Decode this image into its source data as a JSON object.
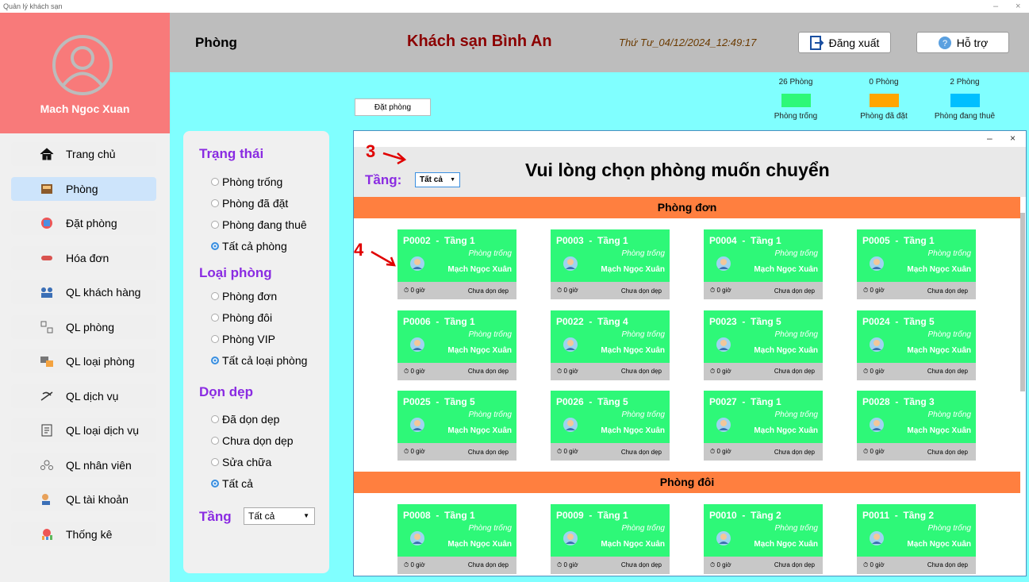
{
  "window": {
    "title": "Quản lý khách sạn",
    "minimize": "–",
    "close": "×"
  },
  "user": {
    "name": "Mach Ngoc Xuan"
  },
  "nav": [
    {
      "label": "Trang chủ",
      "icon": "home-icon"
    },
    {
      "label": "Phòng",
      "icon": "room-icon"
    },
    {
      "label": "Đặt phòng",
      "icon": "booking-icon"
    },
    {
      "label": "Hóa đơn",
      "icon": "invoice-icon"
    },
    {
      "label": "QL khách hàng",
      "icon": "customers-icon"
    },
    {
      "label": "QL phòng",
      "icon": "rooms-manage-icon"
    },
    {
      "label": "QL loại phòng",
      "icon": "room-types-icon"
    },
    {
      "label": "QL dịch vụ",
      "icon": "services-icon"
    },
    {
      "label": "QL loại dịch vụ",
      "icon": "service-types-icon"
    },
    {
      "label": "QL nhân viên",
      "icon": "staff-icon"
    },
    {
      "label": "QL tài khoản",
      "icon": "accounts-icon"
    },
    {
      "label": "Thống kê",
      "icon": "stats-icon"
    }
  ],
  "header": {
    "page_title": "Phòng",
    "hotel_name": "Khách sạn Bình An",
    "datetime": "Thứ Tư_04/12/2024_12:49:17",
    "logout_label": "Đăng xuất",
    "support_label": "Hỗ trợ"
  },
  "toolbar": {
    "book_label": "Đặt phòng"
  },
  "legend": [
    {
      "count": "26 Phòng",
      "label": "Phòng trống",
      "color": "#2ef878"
    },
    {
      "count": "0 Phòng",
      "label": "Phòng đã đặt",
      "color": "#ffa500"
    },
    {
      "count": "2 Phòng",
      "label": "Phòng đang thuê",
      "color": "#00bfff"
    }
  ],
  "filters": {
    "status_title": "Trạng thái",
    "status_options": [
      "Phòng trống",
      "Phòng đã đặt",
      "Phòng đang thuê",
      "Tất cả phòng"
    ],
    "status_selected": 3,
    "type_title": "Loại phòng",
    "type_options": [
      "Phòng đơn",
      "Phòng đôi",
      "Phòng VIP",
      "Tất cả loại phòng"
    ],
    "type_selected": 3,
    "clean_title": "Dọn dẹp",
    "clean_options": [
      "Đã dọn dẹp",
      "Chưa dọn dẹp",
      "Sửa chữa",
      "Tất cả"
    ],
    "clean_selected": 3,
    "floor_title": "Tầng",
    "floor_value": "Tất cả"
  },
  "dialog": {
    "title": "Vui lòng chọn phòng muốn chuyển",
    "floor_label": "Tầng:",
    "floor_value": "Tất cả",
    "minimize": "–",
    "close": "×",
    "annotations": [
      "3",
      "4"
    ],
    "sections": [
      {
        "title": "Phòng đơn",
        "rooms": [
          {
            "id": "P0002  -  Tầng 1"
          },
          {
            "id": "P0003  -  Tầng 1"
          },
          {
            "id": "P0004  -  Tầng 1"
          },
          {
            "id": "P0005  -  Tầng 1"
          },
          {
            "id": "P0006  -  Tầng 1"
          },
          {
            "id": "P0022  -  Tầng 4"
          },
          {
            "id": "P0023  -  Tầng 5"
          },
          {
            "id": "P0024  -  Tầng 5"
          },
          {
            "id": "P0025  -  Tầng 5"
          },
          {
            "id": "P0026  -  Tầng 5"
          },
          {
            "id": "P0027  -  Tầng 1"
          },
          {
            "id": "P0028  -  Tầng 3"
          }
        ]
      },
      {
        "title": "Phòng đôi",
        "rooms": [
          {
            "id": "P0008  -  Tầng 1"
          },
          {
            "id": "P0009  -  Tầng 1"
          },
          {
            "id": "P0010  -  Tầng 2"
          },
          {
            "id": "P0011  -  Tầng 2"
          }
        ]
      }
    ],
    "card": {
      "status": "Phòng trống",
      "guest": "Mạch Ngọc Xuân",
      "hours": "0 giờ",
      "clean": "Chưa dọn dẹp",
      "color": "#2ef878"
    }
  }
}
